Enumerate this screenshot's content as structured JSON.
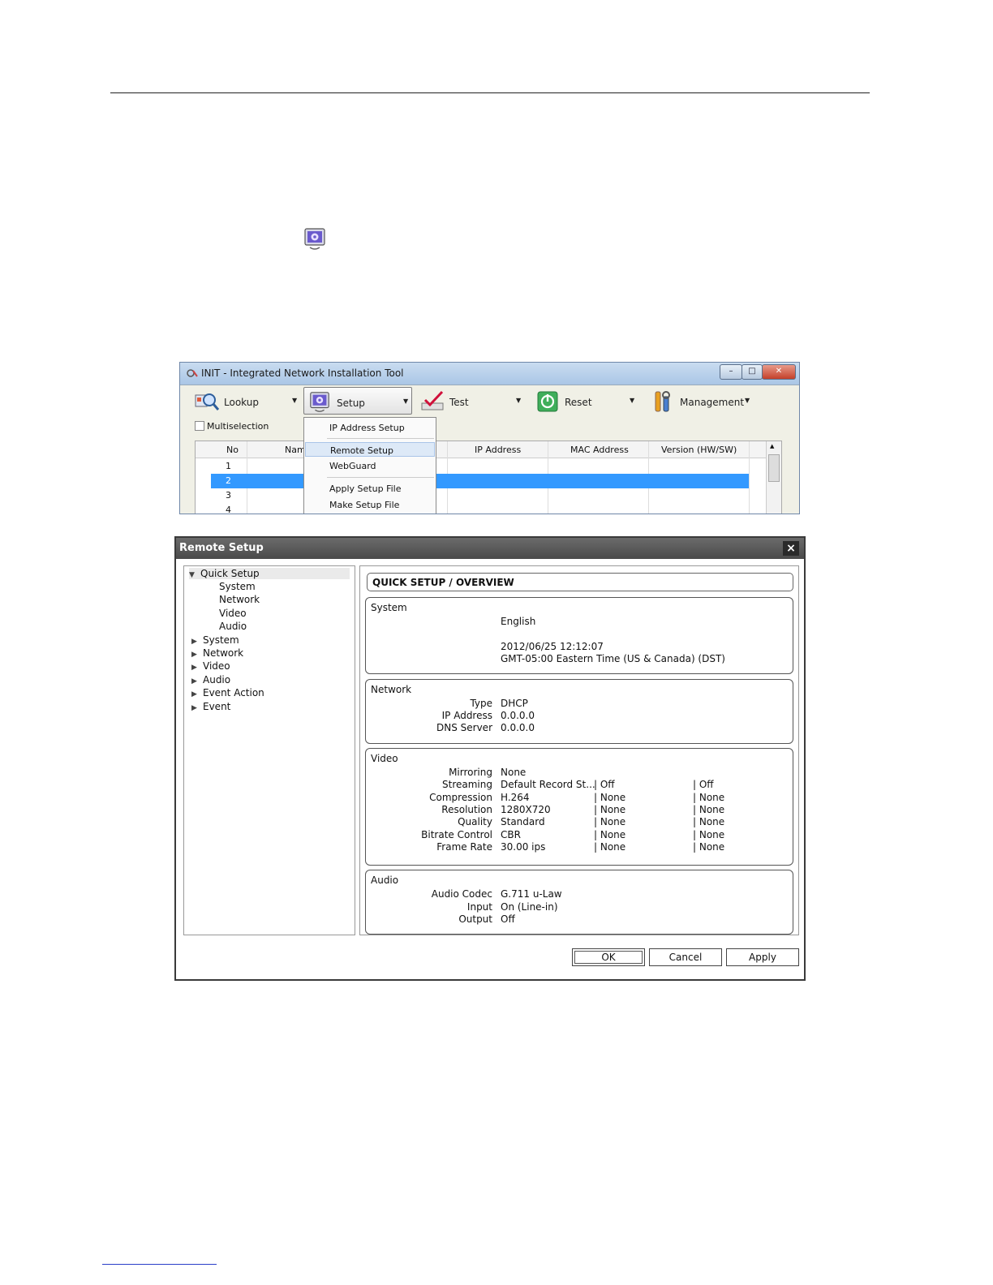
{
  "init_window": {
    "title": "INIT - Integrated Network Installation Tool",
    "toolbar": {
      "lookup": "Lookup",
      "setup": "Setup",
      "test": "Test",
      "reset": "Reset",
      "management": "Management"
    },
    "multiselection": "Multiselection",
    "columns": {
      "no": "No",
      "name": "Nam",
      "ip": "IP Address",
      "mac": "MAC Address",
      "version": "Version (HW/SW)"
    },
    "rows": [
      "1",
      "2",
      "3",
      "4"
    ],
    "selected_row": "2",
    "setup_menu": {
      "ip_address_setup": "IP Address Setup",
      "remote_setup": "Remote Setup",
      "webguard": "WebGuard",
      "apply_setup_file": "Apply Setup File",
      "make_setup_file": "Make Setup File"
    }
  },
  "remote_setup": {
    "title": "Remote Setup",
    "close": "×",
    "tree": {
      "quick_setup": "Quick Setup",
      "quick_children": [
        "System",
        "Network",
        "Video",
        "Audio"
      ],
      "sections": [
        "System",
        "Network",
        "Video",
        "Audio",
        "Event Action",
        "Event"
      ]
    },
    "banner": "QUICK SETUP / OVERVIEW",
    "system": {
      "title": "System",
      "language": "English",
      "datetime": "2012/06/25 12:12:07",
      "timezone": "GMT-05:00 Eastern Time (US & Canada) (DST)"
    },
    "network": {
      "title": "Network",
      "type_label": "Type",
      "type": "DHCP",
      "ip_label": "IP Address",
      "ip": "0.0.0.0",
      "dns_label": "DNS Server",
      "dns": "0.0.0.0"
    },
    "video": {
      "title": "Video",
      "mirroring_label": "Mirroring",
      "mirroring": "None",
      "rows": [
        {
          "label": "Streaming",
          "v1": "Default Record St...",
          "v2": "| Off",
          "v3": "| Off"
        },
        {
          "label": "Compression",
          "v1": "H.264",
          "v2": "| None",
          "v3": "| None"
        },
        {
          "label": "Resolution",
          "v1": "1280X720",
          "v2": "| None",
          "v3": "| None"
        },
        {
          "label": "Quality",
          "v1": "Standard",
          "v2": "| None",
          "v3": "| None"
        },
        {
          "label": "Bitrate Control",
          "v1": "CBR",
          "v2": "| None",
          "v3": "| None"
        },
        {
          "label": "Frame Rate",
          "v1": "30.00 ips",
          "v2": "| None",
          "v3": "| None"
        }
      ]
    },
    "audio": {
      "title": "Audio",
      "codec_label": "Audio Codec",
      "codec": "G.711 u-Law",
      "input_label": "Input",
      "input": "On (Line-in)",
      "output_label": "Output",
      "output": "Off"
    },
    "buttons": {
      "ok": "OK",
      "cancel": "Cancel",
      "apply": "Apply"
    }
  },
  "colors": {
    "selection": "#3399ff",
    "dialog_title": "#4a4a4a"
  },
  "icons": [
    "setup-monitor-icon",
    "lookup-icon",
    "test-icon",
    "reset-icon",
    "management-icon",
    "close-icon",
    "triangle-expanded-icon",
    "triangle-collapsed-icon"
  ]
}
